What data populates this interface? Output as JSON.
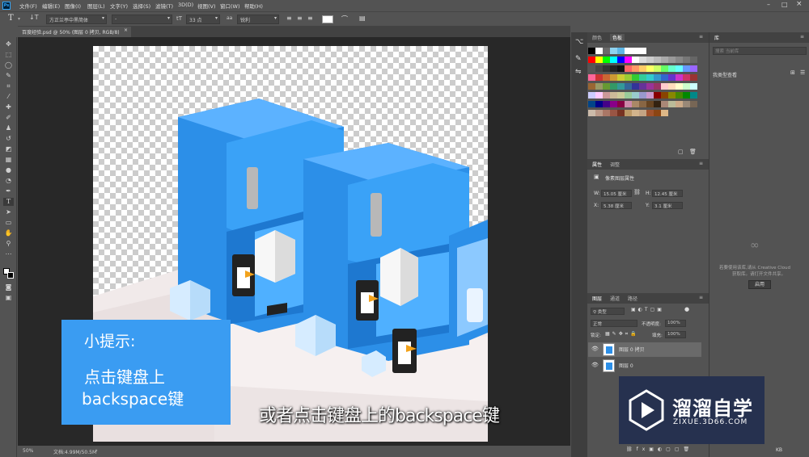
{
  "app": {
    "logo_text": "Ps"
  },
  "menu": [
    "文件(F)",
    "编辑(E)",
    "图像(I)",
    "图层(L)",
    "文字(Y)",
    "选择(S)",
    "滤镜(T)",
    "3D(D)",
    "视图(V)",
    "窗口(W)",
    "帮助(H)"
  ],
  "options": {
    "font_family": "方正兰亭中黑简体",
    "font_style": "-",
    "font_size": "33 点",
    "anti_alias": "锐利",
    "font_size_icon": "tT",
    "aa_icon": "aa"
  },
  "document_tab": {
    "title": "百度经验.psd @ 50% (图层 0 拷贝, RGB/8)",
    "close": "×"
  },
  "status": {
    "zoom": "50%",
    "doc_info": "文档:4.99M/50.5M"
  },
  "panels": {
    "color_tabs": [
      "颜色",
      "色板"
    ],
    "properties_tabs": [
      "属性",
      "调整"
    ],
    "properties_title": "像素图层属性",
    "w_label": "W:",
    "w_value": "15.05 厘米",
    "h_label": "H:",
    "h_value": "12.45 厘米",
    "x_label": "X:",
    "x_value": "5.38 厘米",
    "y_label": "Y:",
    "y_value": "3.1 厘米",
    "layers_tabs": [
      "图层",
      "通道",
      "路径"
    ],
    "filter_kind": "类型",
    "blend_mode": "正常",
    "opacity_label": "不透明度:",
    "opacity_value": "100%",
    "lock_label": "锁定:",
    "fill_label": "填充:",
    "fill_value": "100%",
    "layers": [
      {
        "name": "图层 0 拷贝",
        "selected": true
      },
      {
        "name": "图层 0",
        "selected": false
      }
    ],
    "library_tab": "库",
    "library_search": "搜索 当前库",
    "library_dropdown": "我类型查看",
    "library_message_1": "若要使用该库,请从 Creative Cloud",
    "library_message_2": "获取库。请打开文件共享。",
    "library_button": "启用",
    "library_bottom": "KB"
  },
  "overlay": {
    "tip_title": "小提示:",
    "tip_line1": "点击键盘上",
    "tip_line2": "backspace键",
    "caption": "或者点击键盘上的backspace键",
    "logo_name": "溜溜自学",
    "logo_url": "ZIXUE.3D66.COM"
  }
}
